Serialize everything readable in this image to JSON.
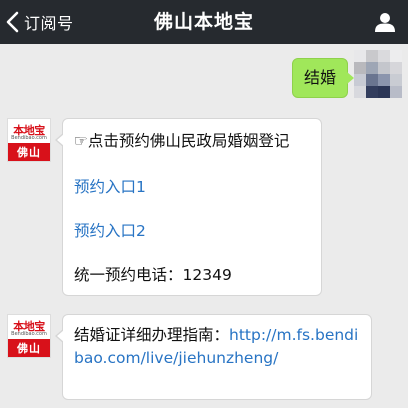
{
  "header": {
    "back_label": "订阅号",
    "title": "佛山本地宝"
  },
  "outgoing": {
    "text": "结婚"
  },
  "incoming_avatar": {
    "brand": "本地宝",
    "site": "Bendibao.com",
    "city": "佛山"
  },
  "messages": [
    {
      "pointer": "☞",
      "line1": "点击预约佛山民政局婚姻登记",
      "link1": "预约入口1",
      "link2": "预约入口2",
      "phone_label": "统一预约电话：",
      "phone": "12349"
    },
    {
      "prefix": "结婚证详细办理指南：",
      "url": "http://m.fs.bendibao.com/live/jiehunzheng/"
    }
  ],
  "colors": {
    "topbar": "#262a2f",
    "outgoing_bubble": "#a0e75a",
    "link": "#2874c4",
    "brand_red": "#d8111a",
    "background": "#ebebeb"
  }
}
